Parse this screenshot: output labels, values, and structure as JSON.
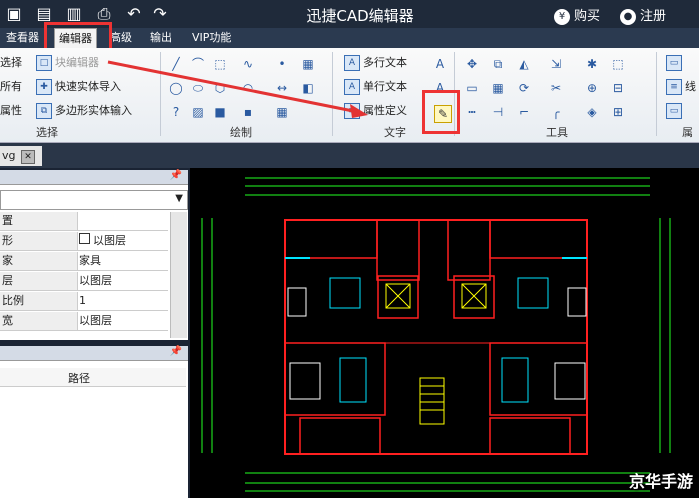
{
  "title": "迅捷CAD编辑器",
  "titlebar_right": {
    "buy": "购买",
    "register": "注册"
  },
  "menu": [
    "查看器",
    "编辑器",
    "高级",
    "输出",
    "VIP功能"
  ],
  "ribbon": {
    "select": {
      "items": [
        "选择",
        "所有",
        "属性"
      ],
      "edit_block": "块编辑器",
      "quick_entity_import": "快速实体导入",
      "polygon_entity_input": "多边形实体输入",
      "label": "选择"
    },
    "draw": {
      "label": "绘制"
    },
    "text": {
      "multiline": "多行文本",
      "singleline": "单行文本",
      "attr_def": "属性定义",
      "label": "文字"
    },
    "tools": {
      "label": "工具"
    },
    "extra": {
      "line": "线",
      "attr": "属"
    }
  },
  "doc_tab": "vg",
  "properties_panel": {
    "rows": [
      {
        "k": "置",
        "v": ""
      },
      {
        "k": "形",
        "v": "以图层"
      },
      {
        "k": "家",
        "v": "家具"
      },
      {
        "k": "层",
        "v": "以图层"
      },
      {
        "k": "比例",
        "v": "1"
      },
      {
        "k": "宽",
        "v": "以图层"
      }
    ]
  },
  "layers_panel": {
    "col_path": "路径"
  },
  "watermark": "京华手游",
  "colors": {
    "highlight": "#e33333",
    "arrow": "#e33333",
    "wall": "#ff2020",
    "dim": "#22ff22",
    "cyan": "#00e5ff",
    "yellow": "#ffff00"
  }
}
